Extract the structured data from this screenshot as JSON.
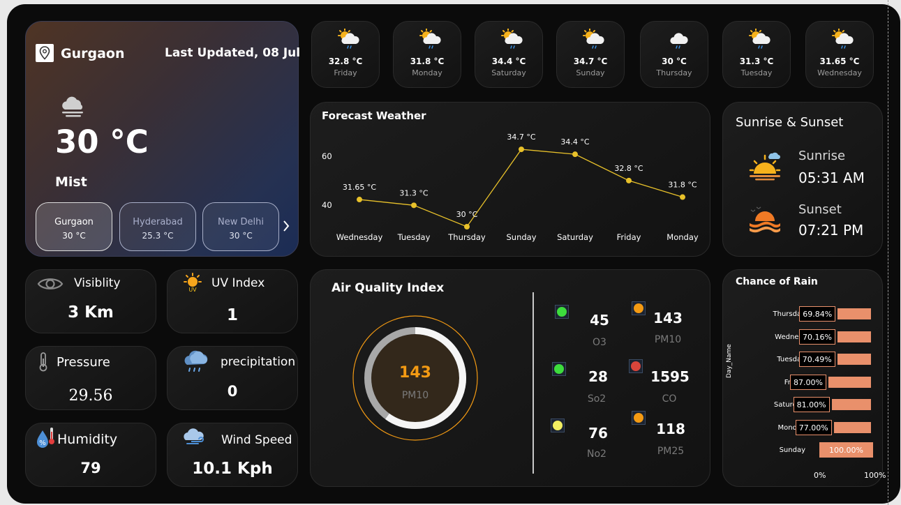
{
  "main": {
    "city": "Gurgaon",
    "last_updated": "Last Updated, 08 Jul",
    "temperature": "30 °C",
    "condition": "Mist",
    "cities": [
      {
        "name": "Gurgaon",
        "temp": "30 °C"
      },
      {
        "name": "Hyderabad",
        "temp": "25.3 °C"
      },
      {
        "name": "New Delhi",
        "temp": "30 °C"
      }
    ]
  },
  "days": [
    {
      "temp": "32.8 °C",
      "day": "Friday"
    },
    {
      "temp": "31.8 °C",
      "day": "Monday"
    },
    {
      "temp": "34.4 °C",
      "day": "Saturday"
    },
    {
      "temp": "34.7 °C",
      "day": "Sunday"
    },
    {
      "temp": "30 °C",
      "day": "Thursday"
    },
    {
      "temp": "31.3 °C",
      "day": "Tuesday"
    },
    {
      "temp": "31.65 °C",
      "day": "Wednesday"
    }
  ],
  "forecast": {
    "title": "Forecast Weather",
    "y_ticks": [
      "60",
      "40"
    ]
  },
  "sun": {
    "title": "Sunrise & Sunset",
    "sunrise_label": "Sunrise",
    "sunrise_time": "05:31 AM",
    "sunset_label": "Sunset",
    "sunset_time": "07:21 PM"
  },
  "stats": {
    "visibility_label": "Visiblity",
    "visibility_value": "3 Km",
    "uv_label": "UV Index",
    "uv_value": "1",
    "pressure_label": "Pressure",
    "pressure_value": "29.56",
    "precip_label": "precipitation",
    "precip_value": "0",
    "humidity_label": "Humidity",
    "humidity_value": "79",
    "wind_label": "Wind Speed",
    "wind_value": "10.1 Kph"
  },
  "aqi": {
    "title": "Air Quality Index",
    "main_value": "143",
    "main_label": "PM10",
    "gauge_fraction": 0.6,
    "pollutants": [
      {
        "value": "45",
        "name": "O3",
        "color": "#3ddc3d"
      },
      {
        "value": "143",
        "name": "PM10",
        "color": "#f39a13"
      },
      {
        "value": "28",
        "name": "So2",
        "color": "#3ddc3d"
      },
      {
        "value": "1595",
        "name": "CO",
        "color": "#d9453b"
      },
      {
        "value": "76",
        "name": "No2",
        "color": "#f2ee62"
      },
      {
        "value": "118",
        "name": "PM25",
        "color": "#f39a13"
      }
    ]
  },
  "rain": {
    "title": "Chance of Rain",
    "axis_title": "Day_Name",
    "x_min_label": "0%",
    "x_max_label": "100%"
  },
  "colors": {
    "accent_line": "#e8c12a",
    "aqi_orange": "#f39a13",
    "rain_bar": "#e9906b"
  },
  "chart_data": [
    {
      "type": "line",
      "title": "Forecast Weather",
      "x": [
        "Wednesday",
        "Tuesday",
        "Thursday",
        "Sunday",
        "Saturday",
        "Friday",
        "Monday"
      ],
      "series": [
        {
          "values": [
            31.65,
            31.3,
            30,
            34.7,
            34.4,
            32.8,
            31.8
          ]
        }
      ],
      "data_labels": [
        "31.65 °C",
        "31.3 °C",
        "30 °C",
        "34.7 °C",
        "34.4 °C",
        "32.8 °C",
        "31.8 °C"
      ],
      "y_tick_labels": [
        "60",
        "40"
      ],
      "grid": false
    },
    {
      "type": "bar",
      "title": "Chance of Rain",
      "ylabel": "Day_Name",
      "categories": [
        "Thursday",
        "Wedne...",
        "Tuesday",
        "Friday",
        "Saturday",
        "Monday",
        "Sunday"
      ],
      "values": [
        69.84,
        70.16,
        70.49,
        87.0,
        81.0,
        77.0,
        100.0
      ],
      "data_labels": [
        "69.84%",
        "70.16%",
        "70.49%",
        "87.00%",
        "81.00%",
        "77.00%",
        "100.00%"
      ],
      "xlim": [
        0,
        100
      ],
      "x_tick_labels": [
        "0%",
        "100%"
      ]
    }
  ]
}
